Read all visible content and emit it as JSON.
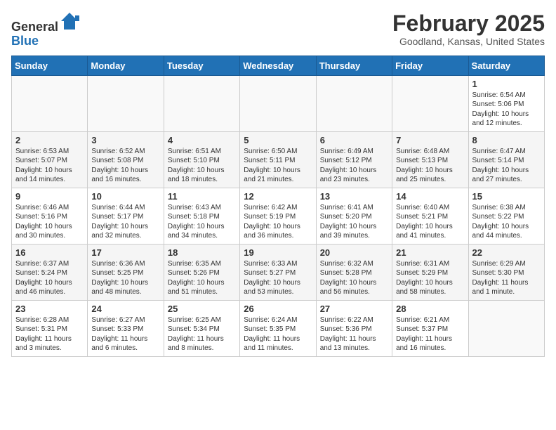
{
  "header": {
    "logo_line1": "General",
    "logo_line2": "Blue",
    "month": "February 2025",
    "location": "Goodland, Kansas, United States"
  },
  "weekdays": [
    "Sunday",
    "Monday",
    "Tuesday",
    "Wednesday",
    "Thursday",
    "Friday",
    "Saturday"
  ],
  "weeks": [
    [
      {
        "day": "",
        "content": ""
      },
      {
        "day": "",
        "content": ""
      },
      {
        "day": "",
        "content": ""
      },
      {
        "day": "",
        "content": ""
      },
      {
        "day": "",
        "content": ""
      },
      {
        "day": "",
        "content": ""
      },
      {
        "day": "1",
        "content": "Sunrise: 6:54 AM\nSunset: 5:06 PM\nDaylight: 10 hours and 12 minutes."
      }
    ],
    [
      {
        "day": "2",
        "content": "Sunrise: 6:53 AM\nSunset: 5:07 PM\nDaylight: 10 hours and 14 minutes."
      },
      {
        "day": "3",
        "content": "Sunrise: 6:52 AM\nSunset: 5:08 PM\nDaylight: 10 hours and 16 minutes."
      },
      {
        "day": "4",
        "content": "Sunrise: 6:51 AM\nSunset: 5:10 PM\nDaylight: 10 hours and 18 minutes."
      },
      {
        "day": "5",
        "content": "Sunrise: 6:50 AM\nSunset: 5:11 PM\nDaylight: 10 hours and 21 minutes."
      },
      {
        "day": "6",
        "content": "Sunrise: 6:49 AM\nSunset: 5:12 PM\nDaylight: 10 hours and 23 minutes."
      },
      {
        "day": "7",
        "content": "Sunrise: 6:48 AM\nSunset: 5:13 PM\nDaylight: 10 hours and 25 minutes."
      },
      {
        "day": "8",
        "content": "Sunrise: 6:47 AM\nSunset: 5:14 PM\nDaylight: 10 hours and 27 minutes."
      }
    ],
    [
      {
        "day": "9",
        "content": "Sunrise: 6:46 AM\nSunset: 5:16 PM\nDaylight: 10 hours and 30 minutes."
      },
      {
        "day": "10",
        "content": "Sunrise: 6:44 AM\nSunset: 5:17 PM\nDaylight: 10 hours and 32 minutes."
      },
      {
        "day": "11",
        "content": "Sunrise: 6:43 AM\nSunset: 5:18 PM\nDaylight: 10 hours and 34 minutes."
      },
      {
        "day": "12",
        "content": "Sunrise: 6:42 AM\nSunset: 5:19 PM\nDaylight: 10 hours and 36 minutes."
      },
      {
        "day": "13",
        "content": "Sunrise: 6:41 AM\nSunset: 5:20 PM\nDaylight: 10 hours and 39 minutes."
      },
      {
        "day": "14",
        "content": "Sunrise: 6:40 AM\nSunset: 5:21 PM\nDaylight: 10 hours and 41 minutes."
      },
      {
        "day": "15",
        "content": "Sunrise: 6:38 AM\nSunset: 5:22 PM\nDaylight: 10 hours and 44 minutes."
      }
    ],
    [
      {
        "day": "16",
        "content": "Sunrise: 6:37 AM\nSunset: 5:24 PM\nDaylight: 10 hours and 46 minutes."
      },
      {
        "day": "17",
        "content": "Sunrise: 6:36 AM\nSunset: 5:25 PM\nDaylight: 10 hours and 48 minutes."
      },
      {
        "day": "18",
        "content": "Sunrise: 6:35 AM\nSunset: 5:26 PM\nDaylight: 10 hours and 51 minutes."
      },
      {
        "day": "19",
        "content": "Sunrise: 6:33 AM\nSunset: 5:27 PM\nDaylight: 10 hours and 53 minutes."
      },
      {
        "day": "20",
        "content": "Sunrise: 6:32 AM\nSunset: 5:28 PM\nDaylight: 10 hours and 56 minutes."
      },
      {
        "day": "21",
        "content": "Sunrise: 6:31 AM\nSunset: 5:29 PM\nDaylight: 10 hours and 58 minutes."
      },
      {
        "day": "22",
        "content": "Sunrise: 6:29 AM\nSunset: 5:30 PM\nDaylight: 11 hours and 1 minute."
      }
    ],
    [
      {
        "day": "23",
        "content": "Sunrise: 6:28 AM\nSunset: 5:31 PM\nDaylight: 11 hours and 3 minutes."
      },
      {
        "day": "24",
        "content": "Sunrise: 6:27 AM\nSunset: 5:33 PM\nDaylight: 11 hours and 6 minutes."
      },
      {
        "day": "25",
        "content": "Sunrise: 6:25 AM\nSunset: 5:34 PM\nDaylight: 11 hours and 8 minutes."
      },
      {
        "day": "26",
        "content": "Sunrise: 6:24 AM\nSunset: 5:35 PM\nDaylight: 11 hours and 11 minutes."
      },
      {
        "day": "27",
        "content": "Sunrise: 6:22 AM\nSunset: 5:36 PM\nDaylight: 11 hours and 13 minutes."
      },
      {
        "day": "28",
        "content": "Sunrise: 6:21 AM\nSunset: 5:37 PM\nDaylight: 11 hours and 16 minutes."
      },
      {
        "day": "",
        "content": ""
      }
    ]
  ]
}
